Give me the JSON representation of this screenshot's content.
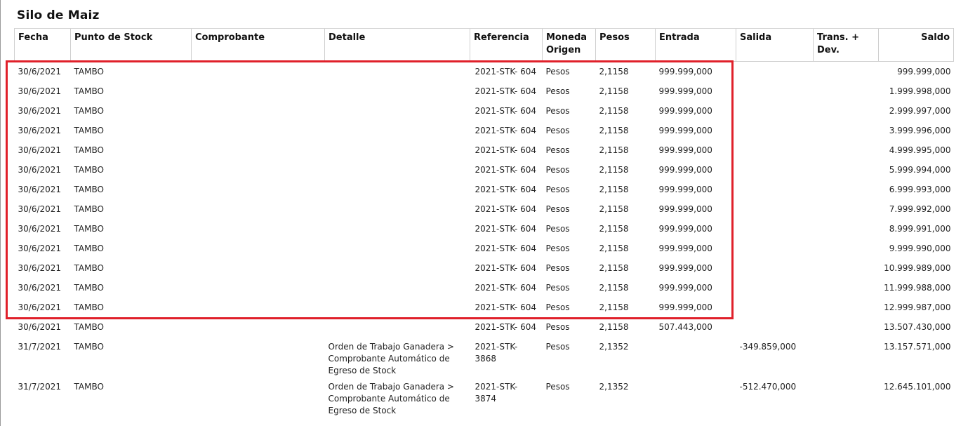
{
  "report": {
    "title": "Silo de Maiz"
  },
  "columns": [
    {
      "label": "Fecha"
    },
    {
      "label": "Punto de Stock"
    },
    {
      "label": "Comprobante"
    },
    {
      "label": "Detalle"
    },
    {
      "label": "Referencia"
    },
    {
      "label": "Moneda Origen"
    },
    {
      "label": "Pesos"
    },
    {
      "label": "Entrada"
    },
    {
      "label": "Salida"
    },
    {
      "label": "Trans. + Dev."
    },
    {
      "label": "Saldo"
    }
  ],
  "rows": [
    {
      "fecha": "30/6/2021",
      "punto": "TAMBO",
      "comprobante": "",
      "detalle": "",
      "referencia": "2021-STK- 604",
      "moneda": "Pesos",
      "pesos": "2,1158",
      "entrada": "999.999,000",
      "salida": "",
      "trans": "",
      "saldo": "999.999,000"
    },
    {
      "fecha": "30/6/2021",
      "punto": "TAMBO",
      "comprobante": "",
      "detalle": "",
      "referencia": "2021-STK- 604",
      "moneda": "Pesos",
      "pesos": "2,1158",
      "entrada": "999.999,000",
      "salida": "",
      "trans": "",
      "saldo": "1.999.998,000"
    },
    {
      "fecha": "30/6/2021",
      "punto": "TAMBO",
      "comprobante": "",
      "detalle": "",
      "referencia": "2021-STK- 604",
      "moneda": "Pesos",
      "pesos": "2,1158",
      "entrada": "999.999,000",
      "salida": "",
      "trans": "",
      "saldo": "2.999.997,000"
    },
    {
      "fecha": "30/6/2021",
      "punto": "TAMBO",
      "comprobante": "",
      "detalle": "",
      "referencia": "2021-STK- 604",
      "moneda": "Pesos",
      "pesos": "2,1158",
      "entrada": "999.999,000",
      "salida": "",
      "trans": "",
      "saldo": "3.999.996,000"
    },
    {
      "fecha": "30/6/2021",
      "punto": "TAMBO",
      "comprobante": "",
      "detalle": "",
      "referencia": "2021-STK- 604",
      "moneda": "Pesos",
      "pesos": "2,1158",
      "entrada": "999.999,000",
      "salida": "",
      "trans": "",
      "saldo": "4.999.995,000"
    },
    {
      "fecha": "30/6/2021",
      "punto": "TAMBO",
      "comprobante": "",
      "detalle": "",
      "referencia": "2021-STK- 604",
      "moneda": "Pesos",
      "pesos": "2,1158",
      "entrada": "999.999,000",
      "salida": "",
      "trans": "",
      "saldo": "5.999.994,000"
    },
    {
      "fecha": "30/6/2021",
      "punto": "TAMBO",
      "comprobante": "",
      "detalle": "",
      "referencia": "2021-STK- 604",
      "moneda": "Pesos",
      "pesos": "2,1158",
      "entrada": "999.999,000",
      "salida": "",
      "trans": "",
      "saldo": "6.999.993,000"
    },
    {
      "fecha": "30/6/2021",
      "punto": "TAMBO",
      "comprobante": "",
      "detalle": "",
      "referencia": "2021-STK- 604",
      "moneda": "Pesos",
      "pesos": "2,1158",
      "entrada": "999.999,000",
      "salida": "",
      "trans": "",
      "saldo": "7.999.992,000"
    },
    {
      "fecha": "30/6/2021",
      "punto": "TAMBO",
      "comprobante": "",
      "detalle": "",
      "referencia": "2021-STK- 604",
      "moneda": "Pesos",
      "pesos": "2,1158",
      "entrada": "999.999,000",
      "salida": "",
      "trans": "",
      "saldo": "8.999.991,000"
    },
    {
      "fecha": "30/6/2021",
      "punto": "TAMBO",
      "comprobante": "",
      "detalle": "",
      "referencia": "2021-STK- 604",
      "moneda": "Pesos",
      "pesos": "2,1158",
      "entrada": "999.999,000",
      "salida": "",
      "trans": "",
      "saldo": "9.999.990,000"
    },
    {
      "fecha": "30/6/2021",
      "punto": "TAMBO",
      "comprobante": "",
      "detalle": "",
      "referencia": "2021-STK- 604",
      "moneda": "Pesos",
      "pesos": "2,1158",
      "entrada": "999.999,000",
      "salida": "",
      "trans": "",
      "saldo": "10.999.989,000"
    },
    {
      "fecha": "30/6/2021",
      "punto": "TAMBO",
      "comprobante": "",
      "detalle": "",
      "referencia": "2021-STK- 604",
      "moneda": "Pesos",
      "pesos": "2,1158",
      "entrada": "999.999,000",
      "salida": "",
      "trans": "",
      "saldo": "11.999.988,000"
    },
    {
      "fecha": "30/6/2021",
      "punto": "TAMBO",
      "comprobante": "",
      "detalle": "",
      "referencia": "2021-STK- 604",
      "moneda": "Pesos",
      "pesos": "2,1158",
      "entrada": "999.999,000",
      "salida": "",
      "trans": "",
      "saldo": "12.999.987,000"
    },
    {
      "fecha": "30/6/2021",
      "punto": "TAMBO",
      "comprobante": "",
      "detalle": "",
      "referencia": "2021-STK- 604",
      "moneda": "Pesos",
      "pesos": "2,1158",
      "entrada": "507.443,000",
      "salida": "",
      "trans": "",
      "saldo": "13.507.430,000"
    },
    {
      "fecha": "31/7/2021",
      "punto": "TAMBO",
      "comprobante": "",
      "detalle": "Orden de Trabajo Ganadera > Comprobante Automático de Egreso de Stock",
      "referencia": "2021-STK- 3868",
      "moneda": "Pesos",
      "pesos": "2,1352",
      "entrada": "",
      "salida": "-349.859,000",
      "trans": "",
      "saldo": "13.157.571,000"
    },
    {
      "fecha": "31/7/2021",
      "punto": "TAMBO",
      "comprobante": "",
      "detalle": "Orden de Trabajo Ganadera > Comprobante Automático de Egreso de Stock",
      "referencia": "2021-STK- 3874",
      "moneda": "Pesos",
      "pesos": "2,1352",
      "entrada": "",
      "salida": "-512.470,000",
      "trans": "",
      "saldo": "12.645.101,000"
    }
  ],
  "highlight": {
    "color": "#e0202a"
  }
}
